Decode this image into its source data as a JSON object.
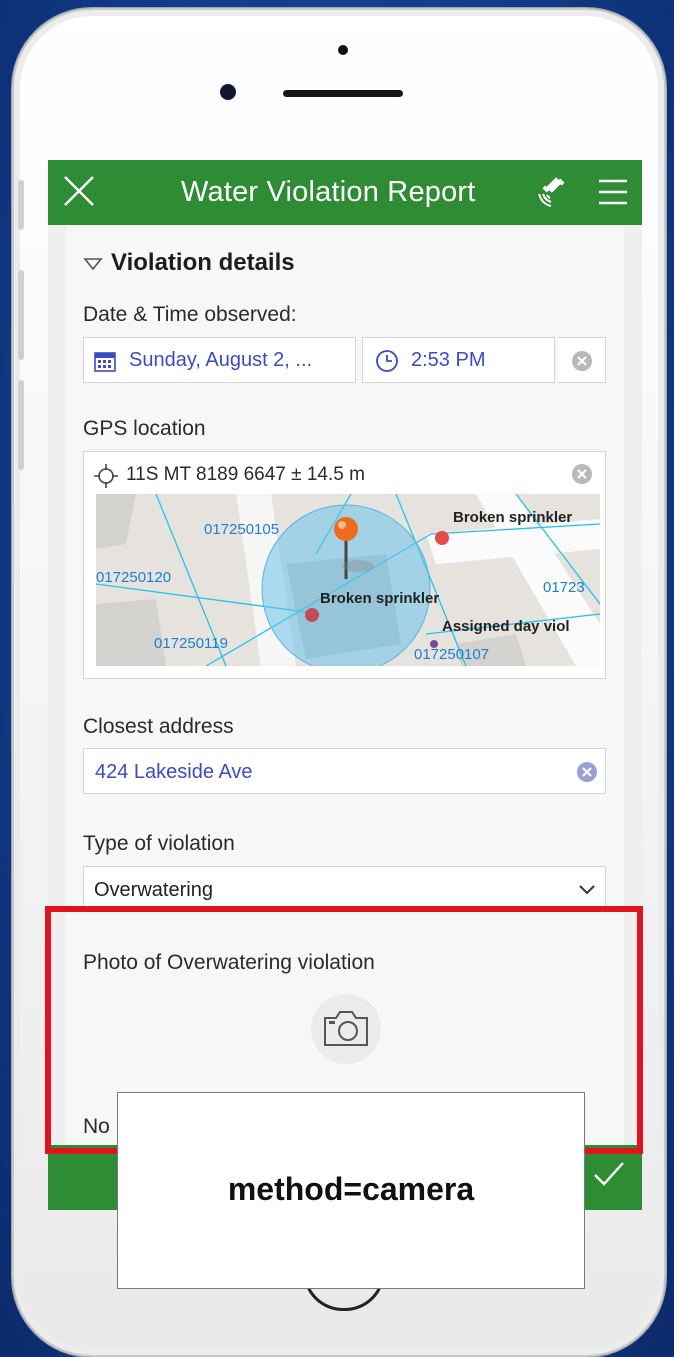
{
  "app": {
    "title": "Water Violation Report",
    "icons": {
      "close": "close-icon",
      "gps": "satellite-gps-icon",
      "menu": "hamburger-menu-icon"
    }
  },
  "form": {
    "section_title": "Violation details",
    "datetime": {
      "label": "Date & Time observed:",
      "date_value": "Sunday, August 2, ...",
      "time_value": "2:53 PM"
    },
    "gps": {
      "label": "GPS location",
      "value": "11S MT 8189 6647 ± 14.5 m",
      "map_labels": [
        "017250105",
        "017250120",
        "017250119",
        "017250107",
        "01723",
        "Broken sprinkler",
        "Broken sprinkler",
        "Assigned day viol"
      ]
    },
    "address": {
      "label": "Closest address",
      "value": "424 Lakeside Ave"
    },
    "violation_type": {
      "label": "Type of violation",
      "selected": "Overwatering"
    },
    "photo": {
      "label": "Photo of Overwatering violation"
    },
    "notes": {
      "label_partial": "No"
    }
  },
  "callout": {
    "text": "method=camera"
  },
  "colors": {
    "appbar": "#2e8c35",
    "highlight": "#e0141c",
    "link_text": "#3b4bc2",
    "background": "#133c8c"
  }
}
